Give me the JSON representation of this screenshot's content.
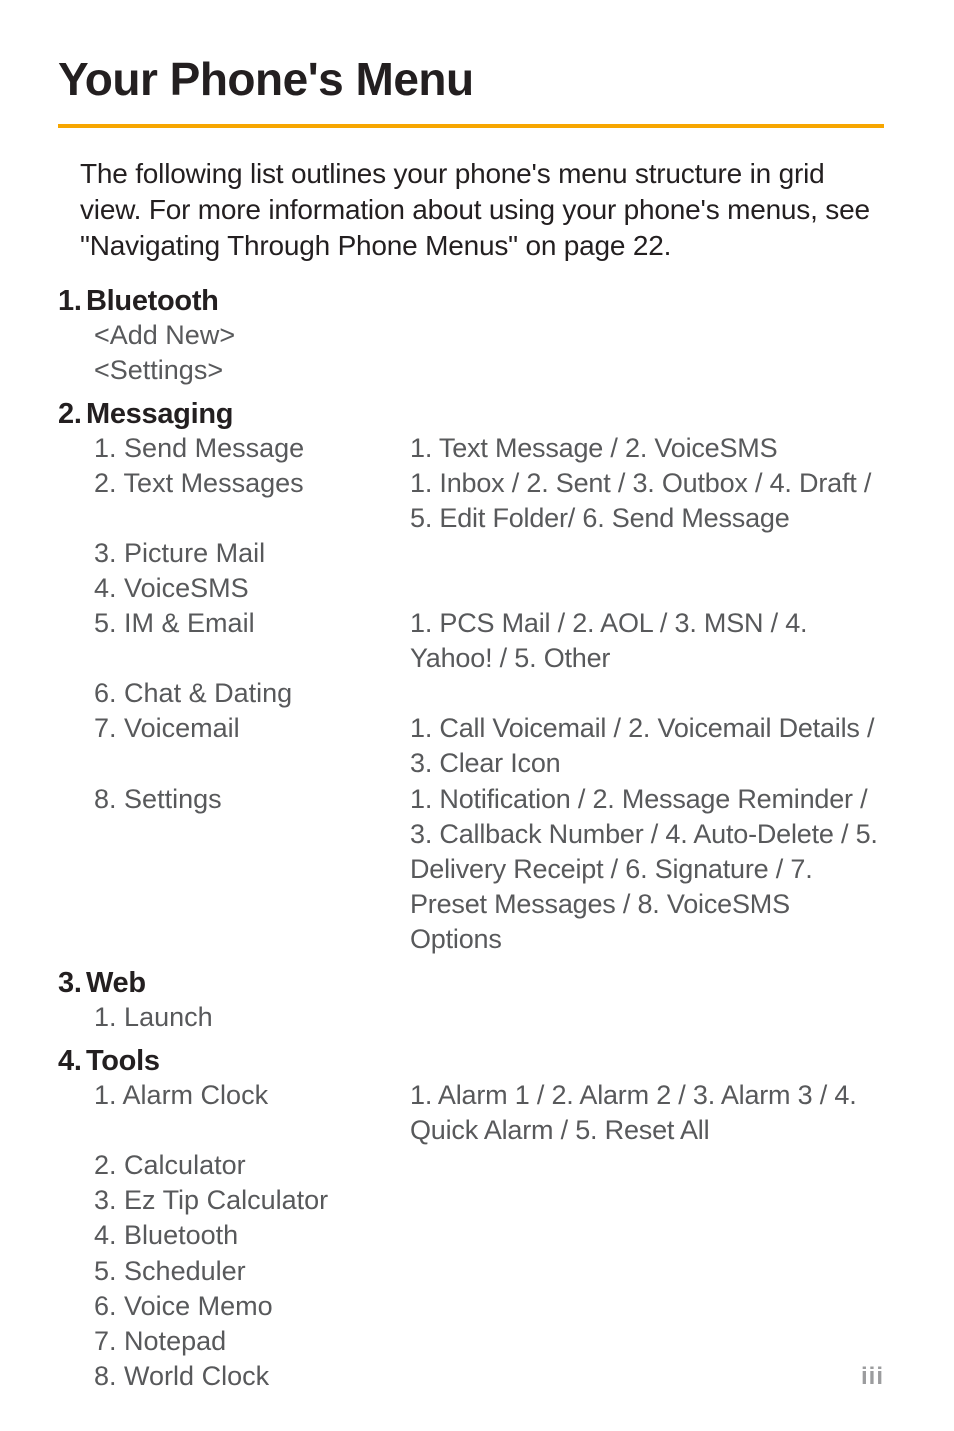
{
  "title": "Your Phone's Menu",
  "intro": "The following list outlines your phone's menu structure  in grid view. For more information about using your phone's menus, see \"Navigating Through Phone Menus\" on page 22.",
  "page_number": "iii",
  "sections": [
    {
      "num": "1.",
      "label": "Bluetooth",
      "plain_items": [
        "<Add New>",
        "<Settings>"
      ]
    },
    {
      "num": "2.",
      "label": "Messaging",
      "rows": [
        {
          "n": "1.",
          "left": "Send Message",
          "right": "1. Text Message / 2. VoiceSMS"
        },
        {
          "n": "2.",
          "left": "Text Messages",
          "right": "1. Inbox / 2. Sent / 3. Outbox / 4. Draft / 5. Edit Folder/ 6. Send Message"
        },
        {
          "n": "3.",
          "left": "Picture Mail",
          "right": ""
        },
        {
          "n": "4.",
          "left": "VoiceSMS",
          "right": ""
        },
        {
          "n": "5.",
          "left": "IM & Email",
          "right": "1. PCS Mail / 2. AOL / 3. MSN / 4. Yahoo! / 5. Other"
        },
        {
          "n": "6.",
          "left": "Chat & Dating",
          "right": ""
        },
        {
          "n": "7.",
          "left": "Voicemail",
          "right": "1. Call Voicemail / 2. Voicemail Details / 3. Clear Icon"
        },
        {
          "n": "8.",
          "left": "Settings",
          "right": "1. Notification / 2. Message Reminder / 3. Callback Number / 4. Auto-Delete / 5. Delivery Receipt / 6. Signature / 7. Preset Messages / 8. VoiceSMS Options"
        }
      ]
    },
    {
      "num": "3.",
      "label": "Web",
      "rows": [
        {
          "n": "1.",
          "left": "Launch",
          "right": ""
        }
      ]
    },
    {
      "num": "4.",
      "label": "Tools",
      "rows": [
        {
          "n": "1.",
          "left": "Alarm Clock",
          "right": "1. Alarm 1 / 2. Alarm 2 / 3. Alarm 3 / 4. Quick Alarm / 5. Reset All"
        },
        {
          "n": "2.",
          "left": "Calculator",
          "right": ""
        },
        {
          "n": "3.",
          "left": "Ez Tip Calculator",
          "right": ""
        },
        {
          "n": "4.",
          "left": "Bluetooth",
          "right": ""
        },
        {
          "n": "5.",
          "left": "Scheduler",
          "right": ""
        },
        {
          "n": "6.",
          "left": "Voice Memo",
          "right": ""
        },
        {
          "n": "7.",
          "left": "Notepad",
          "right": ""
        },
        {
          "n": "8.",
          "left": "World Clock",
          "right": ""
        }
      ]
    }
  ]
}
